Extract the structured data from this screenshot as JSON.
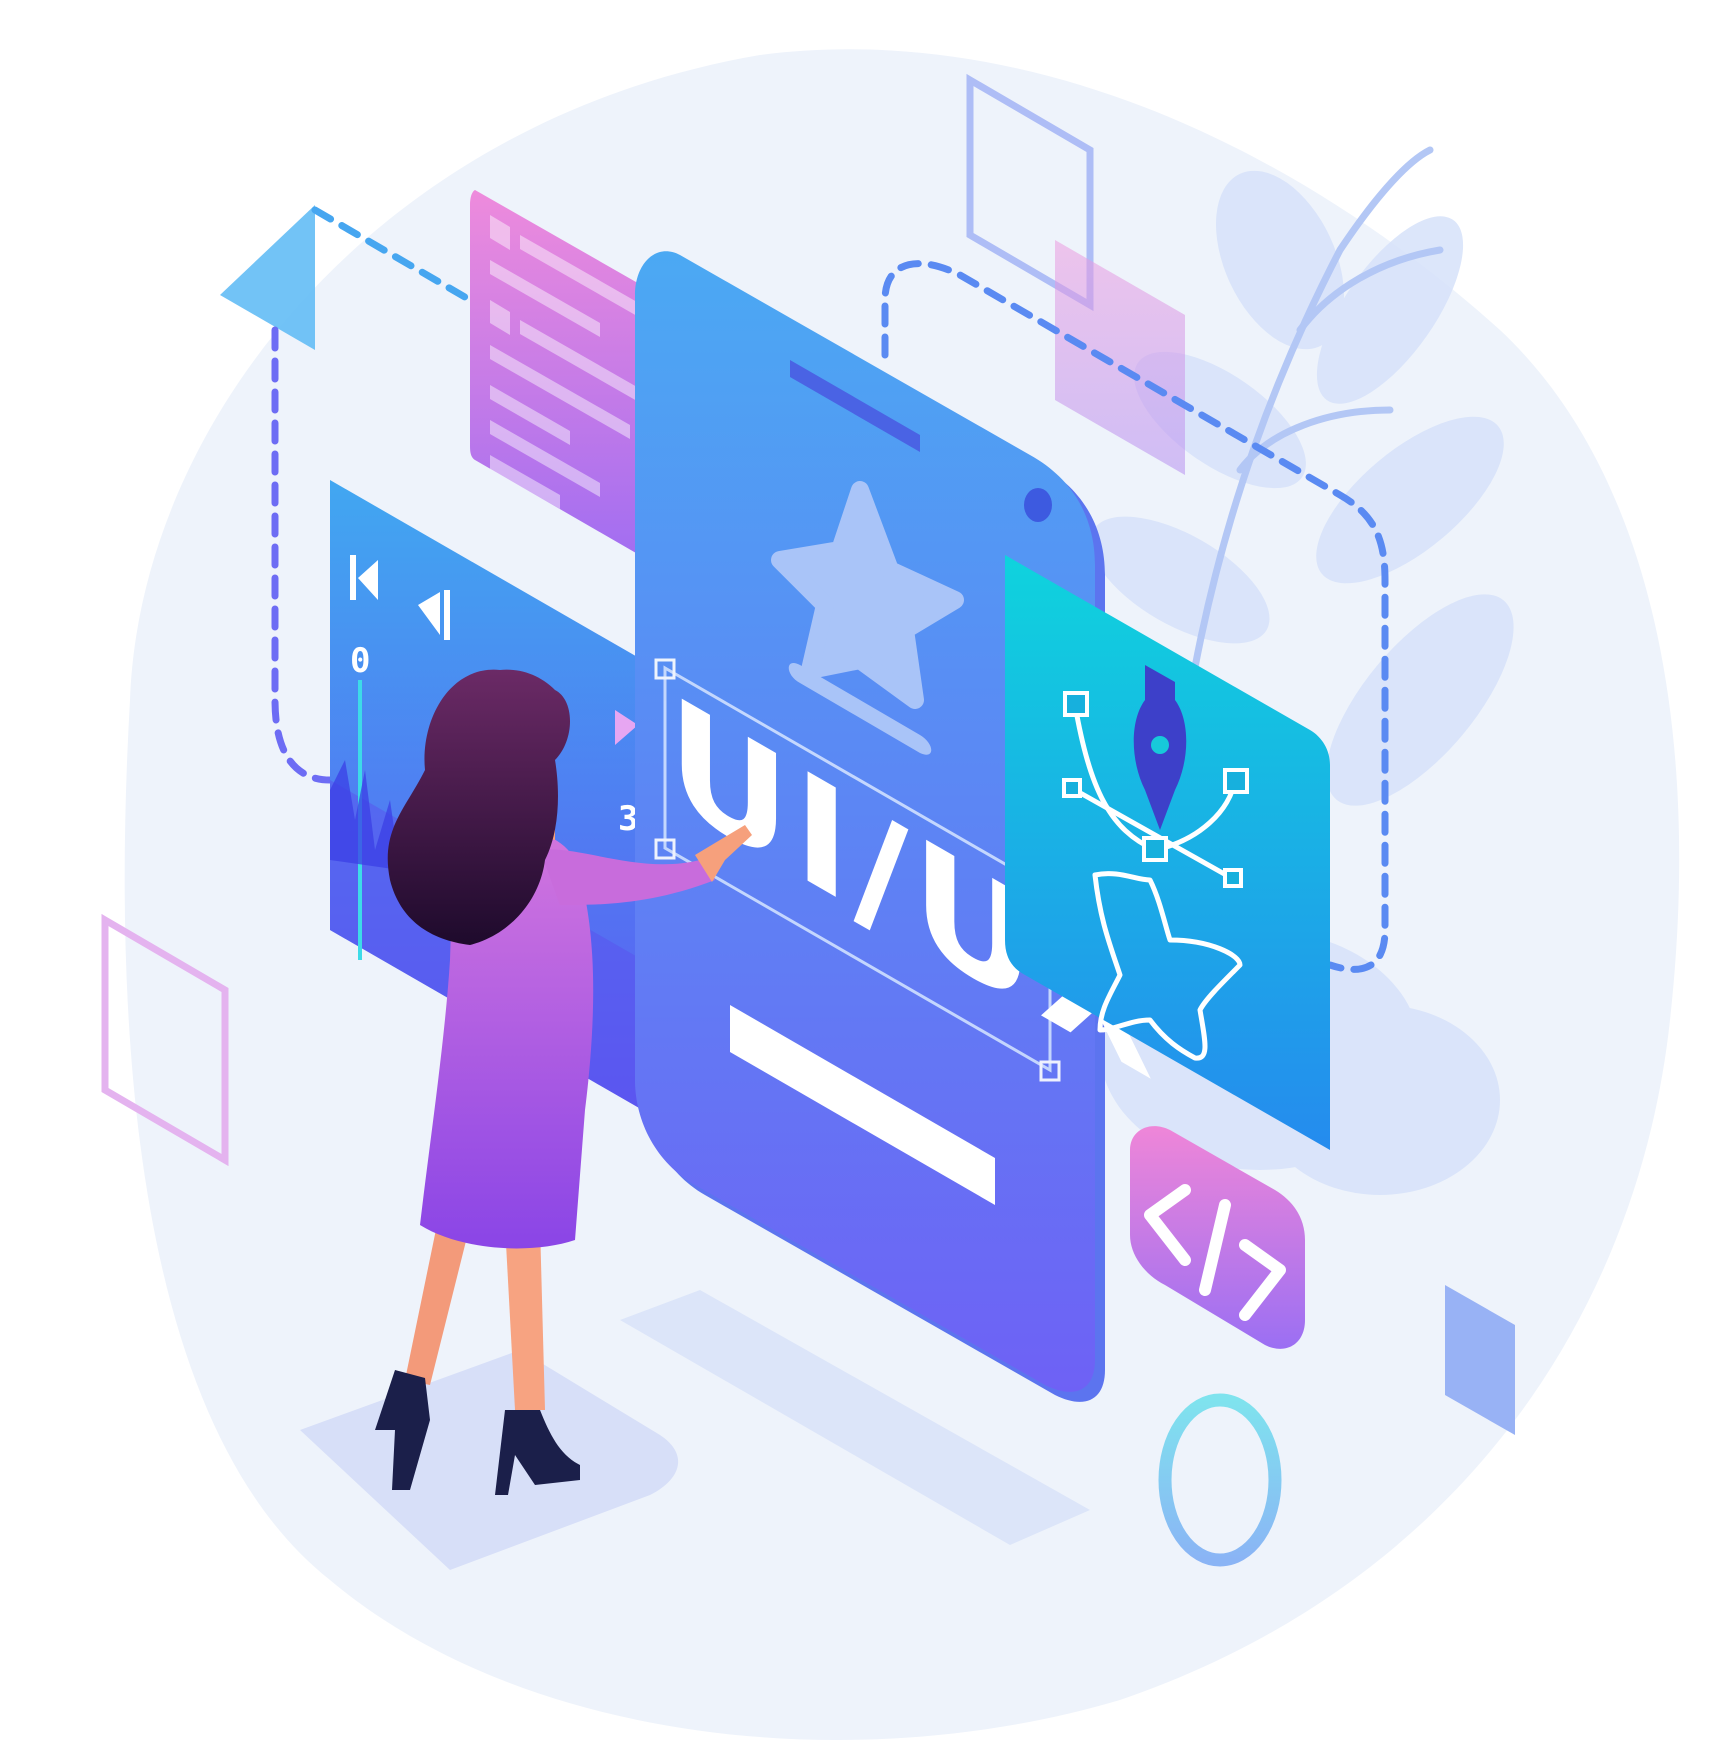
{
  "scene": {
    "phone_label": "UI/UX",
    "code_badge_label": "</>",
    "timeline_numbers": [
      "0",
      "3"
    ]
  },
  "colors": {
    "background_blob": "#eef3fb",
    "phone_gradient_top": "#4aa8f2",
    "phone_gradient_bottom": "#6f63f5",
    "card_pink": "#e98be0",
    "card_purple": "#9a6cf2",
    "card_teal": "#12d0dc",
    "card_blue": "#2390ee",
    "dress": "#c261d9",
    "hair": "#3a1240",
    "skin": "#f6a07c",
    "shoes": "#1b1f4a"
  },
  "icons": [
    "star-icon",
    "pen-tool-icon",
    "code-icon",
    "play-icon",
    "skip-back-icon",
    "rewind-icon",
    "ring-icon",
    "plant-leaves"
  ]
}
